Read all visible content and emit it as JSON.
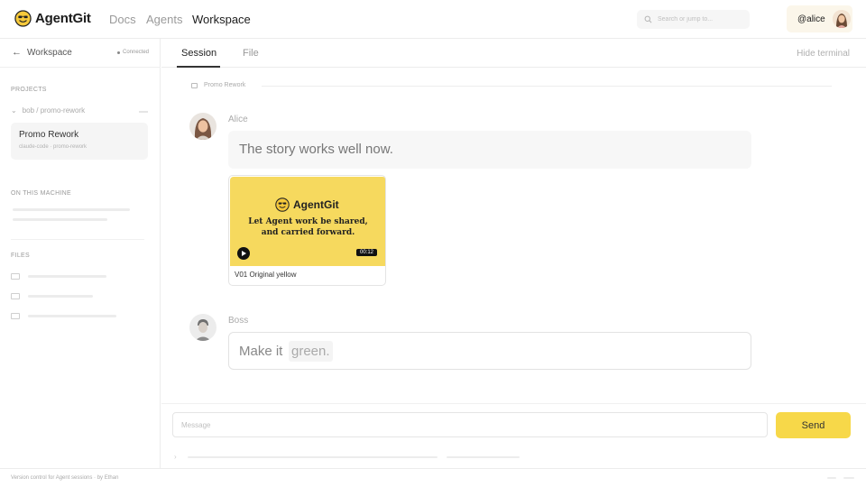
{
  "brand": {
    "name": "AgentGit"
  },
  "nav": {
    "docs": "Docs",
    "agents": "Agents",
    "workspace": "Workspace"
  },
  "search": {
    "placeholder": "Search or jump to..."
  },
  "user": {
    "handle": "@alice"
  },
  "sidebar": {
    "title": "Workspace",
    "status": "Connected",
    "projects_heading": "PROJECTS",
    "repo": "bob / promo-rework",
    "project_card": {
      "title": "Promo Rework",
      "subtitle": "claude-code · promo-rework"
    },
    "machine_heading": "ON THIS MACHINE",
    "files_heading": "FILES"
  },
  "tabs": {
    "session": "Session",
    "file": "File",
    "hide_terminal": "Hide terminal"
  },
  "conversation": {
    "breadcrumb": "Promo Rework",
    "messages": [
      {
        "author": "Alice",
        "text": "The story works well now."
      },
      {
        "author": "Boss",
        "text_prefix": "Make it",
        "text_highlight": "green."
      }
    ],
    "attachment": {
      "brand": "AgentGit",
      "line1": "Let Agent work be shared,",
      "line2": "and carried forward.",
      "duration": "00:12",
      "caption": "V01 Original yellow"
    }
  },
  "composer": {
    "placeholder": "Message",
    "send_label": "Send"
  },
  "footer": {
    "text": "Version control for Agent sessions · by Ethan"
  },
  "colors": {
    "accent": "#f7d849",
    "thumbnail": "#f6d95e"
  }
}
